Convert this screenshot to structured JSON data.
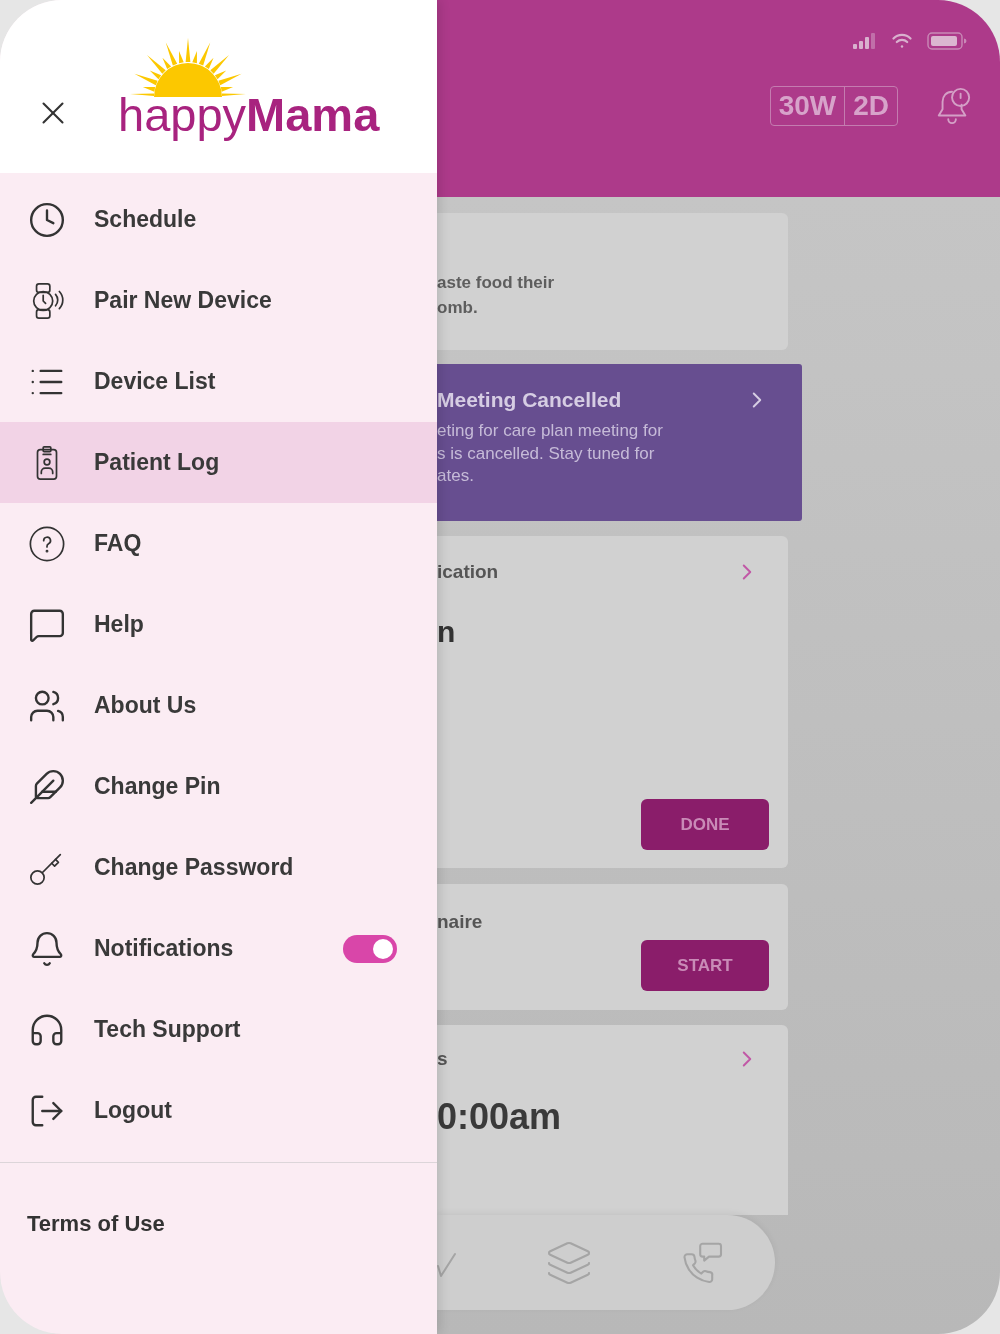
{
  "drawer": {
    "logo": "happy**Mama**",
    "items": [
      {
        "label": "Schedule",
        "kind": "link",
        "selected": false
      },
      {
        "label": "Pair New Device",
        "kind": "link",
        "selected": false
      },
      {
        "label": "Device List",
        "kind": "link",
        "selected": false
      },
      {
        "label": "Patient Log",
        "kind": "link",
        "selected": true
      },
      {
        "label": "FAQ",
        "kind": "link",
        "selected": false
      },
      {
        "label": "Help",
        "kind": "link",
        "selected": false
      },
      {
        "label": "About Us",
        "kind": "link",
        "selected": false
      },
      {
        "label": "Change Pin",
        "kind": "link",
        "selected": false
      },
      {
        "label": "Change Password",
        "kind": "link",
        "selected": false
      },
      {
        "label": "Notifications",
        "kind": "toggle",
        "selected": false,
        "on": true
      },
      {
        "label": "Tech Support",
        "kind": "link",
        "selected": false
      },
      {
        "label": "Logout",
        "kind": "link",
        "selected": false
      }
    ],
    "footer_link": "Terms of Use"
  },
  "app_screen": {
    "week_badge": [
      "30W",
      "2D"
    ],
    "cards": [
      {
        "kind": "note",
        "lines": [
          "aste food their",
          "omb."
        ]
      },
      {
        "kind": "alert",
        "title": "Meeting Cancelled",
        "lines": [
          "eting for care plan meeting for",
          "s is cancelled. Stay tuned for",
          "ates."
        ]
      },
      {
        "kind": "task",
        "title": "ication",
        "value": "n",
        "button": "DONE"
      },
      {
        "kind": "survey",
        "title": "naire",
        "button": "START"
      },
      {
        "kind": "appointment",
        "title": "s",
        "value": "0:00am"
      }
    ]
  }
}
